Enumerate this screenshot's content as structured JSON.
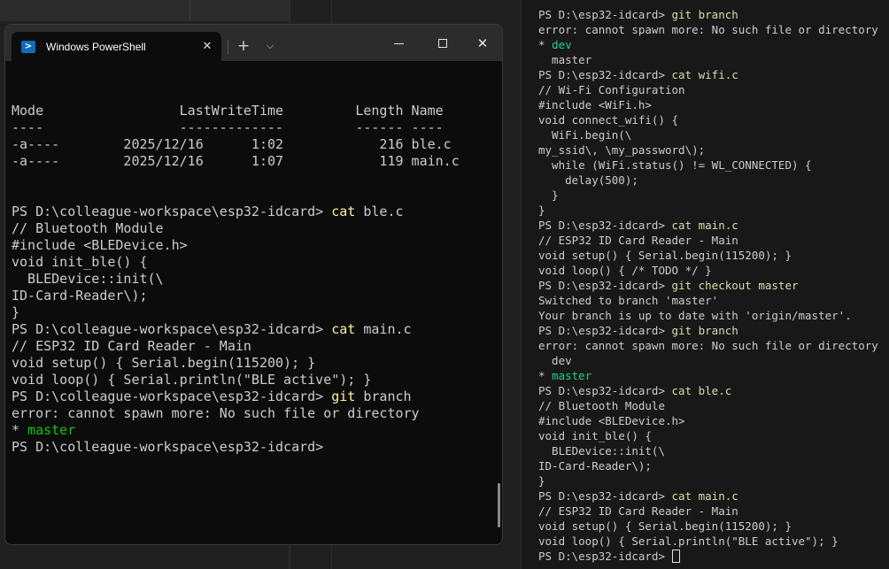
{
  "powershell": {
    "tab_title": "Windows PowerShell",
    "tab_icon": "powershell-icon",
    "lines": [
      {
        "text": ""
      },
      {
        "text": ""
      },
      {
        "text": "Mode                 LastWriteTime         Length Name"
      },
      {
        "text": "----                 -------------         ------ ----"
      },
      {
        "text": "-a----        2025/12/16      1:02            216 ble.c"
      },
      {
        "text": "-a----        2025/12/16      1:07            119 main.c"
      },
      {
        "text": ""
      },
      {
        "text": ""
      },
      {
        "text": "PS D:\\colleague-workspace\\esp32-idcard> ",
        "cmd": "cat",
        "arg": " ble.c"
      },
      {
        "text": "// Bluetooth Module"
      },
      {
        "text": "#include <BLEDevice.h>"
      },
      {
        "text": "void init_ble() {"
      },
      {
        "text": "  BLEDevice::init(\\"
      },
      {
        "text": "ID-Card-Reader\\);"
      },
      {
        "text": "}"
      },
      {
        "text": "PS D:\\colleague-workspace\\esp32-idcard> ",
        "cmd": "cat",
        "arg": " main.c"
      },
      {
        "text": "// ESP32 ID Card Reader - Main"
      },
      {
        "text": "void setup() { Serial.begin(115200); }"
      },
      {
        "text": "void loop() { Serial.println(\"BLE active\"); }"
      },
      {
        "text": "PS D:\\colleague-workspace\\esp32-idcard> ",
        "cmd": "git",
        "arg": " branch"
      },
      {
        "text": "error: cannot spawn more: No such file or directory"
      },
      {
        "text": "* ",
        "branch": "master"
      },
      {
        "text": "PS D:\\colleague-workspace\\esp32-idcard>"
      }
    ]
  },
  "right_terminal": {
    "lines": [
      {
        "text": "PS D:\\esp32-idcard> ",
        "cmd": "git branch"
      },
      {
        "text": "error: cannot spawn more: No such file or directory"
      },
      {
        "text": "* ",
        "branch": "dev"
      },
      {
        "text": "  master"
      },
      {
        "text": "PS D:\\esp32-idcard> ",
        "cmd": "cat wifi.c"
      },
      {
        "text": "// Wi-Fi Configuration"
      },
      {
        "text": "#include <WiFi.h>"
      },
      {
        "text": "void connect_wifi() {"
      },
      {
        "text": "  WiFi.begin(\\"
      },
      {
        "text": "my_ssid\\, \\my_password\\);"
      },
      {
        "text": "  while (WiFi.status() != WL_CONNECTED) {"
      },
      {
        "text": "    delay(500);"
      },
      {
        "text": "  }"
      },
      {
        "text": "}"
      },
      {
        "text": "PS D:\\esp32-idcard> ",
        "cmd": "cat main.c"
      },
      {
        "text": "// ESP32 ID Card Reader - Main"
      },
      {
        "text": "void setup() { Serial.begin(115200); }"
      },
      {
        "text": "void loop() { /* TODO */ }"
      },
      {
        "text": "PS D:\\esp32-idcard> ",
        "cmd": "git checkout master"
      },
      {
        "text": "Switched to branch 'master'"
      },
      {
        "text": "Your branch is up to date with 'origin/master'."
      },
      {
        "text": "PS D:\\esp32-idcard> ",
        "cmd": "git branch"
      },
      {
        "text": "error: cannot spawn more: No such file or directory"
      },
      {
        "text": "  dev"
      },
      {
        "text": "* ",
        "branch": "master"
      },
      {
        "text": "PS D:\\esp32-idcard> ",
        "cmd": "cat ble.c"
      },
      {
        "text": "// Bluetooth Module"
      },
      {
        "text": "#include <BLEDevice.h>"
      },
      {
        "text": "void init_ble() {"
      },
      {
        "text": "  BLEDevice::init(\\"
      },
      {
        "text": "ID-Card-Reader\\);"
      },
      {
        "text": "}"
      },
      {
        "text": "PS D:\\esp32-idcard> ",
        "cmd": "cat main.c"
      },
      {
        "text": "// ESP32 ID Card Reader - Main"
      },
      {
        "text": "void setup() { Serial.begin(115200); }"
      },
      {
        "text": "void loop() { Serial.println(\"BLE active\"); }"
      },
      {
        "text": "PS D:\\esp32-idcard> ",
        "cursor": true
      }
    ]
  },
  "colors": {
    "ps_background": "#0c0c0c",
    "ps_command": "#f9f1a5",
    "ps_branch": "#16c60c",
    "rt_command": "#dcdcaa",
    "rt_branch": "#23d18b"
  }
}
